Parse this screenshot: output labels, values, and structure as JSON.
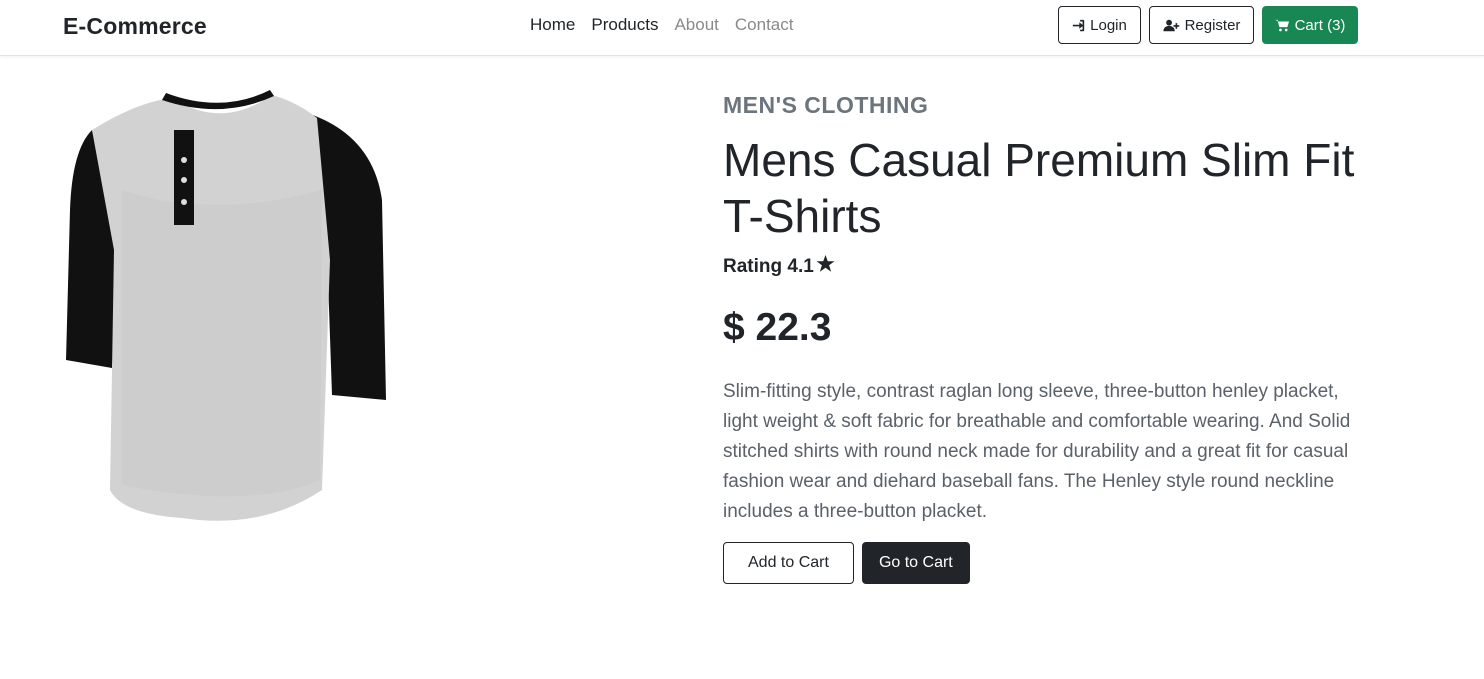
{
  "navbar": {
    "brand": "E-Commerce",
    "links": [
      {
        "label": "Home"
      },
      {
        "label": "Products"
      },
      {
        "label": "About"
      },
      {
        "label": "Contact"
      }
    ],
    "login_label": "Login",
    "register_label": "Register",
    "cart_label": "Cart (3)"
  },
  "product": {
    "category": "MEN'S CLOTHING",
    "title": "Mens Casual Premium Slim Fit T-Shirts",
    "rating_label": "Rating 4.1",
    "price": "$ 22.3",
    "description": "Slim-fitting style, contrast raglan long sleeve, three-button henley placket, light weight & soft fabric for breathable and comfortable wearing. And Solid stitched shirts with round neck made for durability and a great fit for casual fashion wear and diehard baseball fans. The Henley style round neckline includes a three-button placket."
  },
  "actions": {
    "add_to_cart": "Add to Cart",
    "go_to_cart": "Go to Cart"
  },
  "colors": {
    "cart_button": "#198754",
    "dark_button": "#212529",
    "category_text": "#6c757d"
  }
}
